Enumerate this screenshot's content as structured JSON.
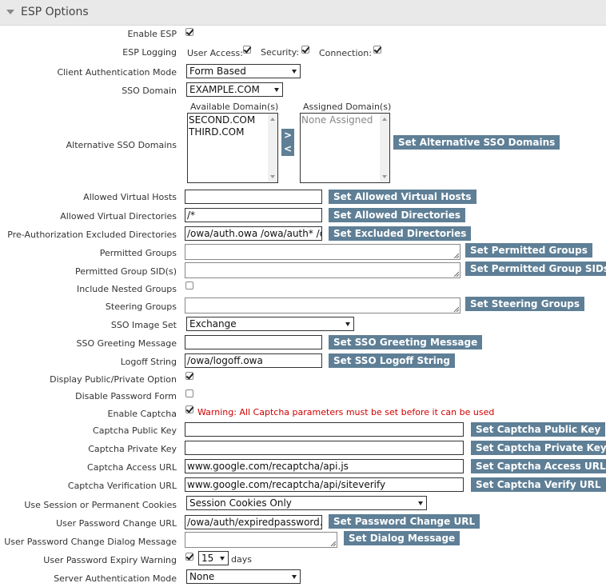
{
  "section_title": "ESP Options",
  "labels": {
    "enable_esp": "Enable ESP",
    "esp_logging": "ESP Logging",
    "client_auth_mode": "Client Authentication Mode",
    "sso_domain": "SSO Domain",
    "alt_sso_domains": "Alternative SSO Domains",
    "allowed_virtual_hosts": "Allowed Virtual Hosts",
    "allowed_virtual_dirs": "Allowed Virtual Directories",
    "preauth_excluded_dirs": "Pre-Authorization Excluded Directories",
    "permitted_groups": "Permitted Groups",
    "permitted_group_sids": "Permitted Group SID(s)",
    "include_nested_groups": "Include Nested Groups",
    "steering_groups": "Steering Groups",
    "sso_image_set": "SSO Image Set",
    "sso_greeting_message": "SSO Greeting Message",
    "logoff_string": "Logoff String",
    "display_public_private": "Display Public/Private Option",
    "disable_password_form": "Disable Password Form",
    "enable_captcha": "Enable Captcha",
    "captcha_public_key": "Captcha Public Key",
    "captcha_private_key": "Captcha Private Key",
    "captcha_access_url": "Captcha Access URL",
    "captcha_verification_url": "Captcha Verification URL",
    "session_cookies": "Use Session or Permanent Cookies",
    "password_change_url": "User Password Change URL",
    "password_change_dialog": "User Password Change Dialog Message",
    "password_expiry_warning": "User Password Expiry Warning",
    "server_auth_mode": "Server Authentication Mode"
  },
  "logging": {
    "user_access": "User Access:",
    "security": "Security:",
    "connection": "Connection:"
  },
  "checks": {
    "enable_esp": true,
    "user_access": true,
    "security": true,
    "connection": true,
    "include_nested_groups": false,
    "display_public_private": true,
    "disable_password_form": false,
    "enable_captcha": true,
    "password_expiry_warning": true
  },
  "selects": {
    "client_auth_mode": "Form Based",
    "sso_domain": "EXAMPLE.COM",
    "sso_image_set": "Exchange",
    "session_cookies": "Session Cookies Only",
    "expiry_days": "15",
    "server_auth_mode": "None"
  },
  "domains": {
    "available_header": "Available Domain(s)",
    "assigned_header": "Assigned Domain(s)",
    "available": [
      "SECOND.COM",
      "THIRD.COM"
    ],
    "assigned_placeholder": "None Assigned",
    "move_right": ">",
    "move_left": "<"
  },
  "values": {
    "allowed_virtual_hosts": "",
    "allowed_virtual_dirs": "/*",
    "preauth_excluded_dirs": "/owa/auth.owa /owa/auth* /o",
    "sso_greeting_message": "",
    "logoff_string": "/owa/logoff.owa",
    "captcha_public_key": "",
    "captcha_private_key": "",
    "captcha_access_url": "www.google.com/recaptcha/api.js",
    "captcha_verification_url": "www.google.com/recaptcha/api/siteverify",
    "password_change_url": "/owa/auth/expiredpassword.a"
  },
  "buttons": {
    "set_alt_sso_domains": "Set Alternative SSO Domains",
    "set_allowed_virtual_hosts": "Set Allowed Virtual Hosts",
    "set_allowed_directories": "Set Allowed Directories",
    "set_excluded_directories": "Set Excluded Directories",
    "set_permitted_groups": "Set Permitted Groups",
    "set_permitted_group_sids": "Set Permitted Group SIDs",
    "set_steering_groups": "Set Steering Groups",
    "set_sso_greeting": "Set SSO Greeting Message",
    "set_sso_logoff": "Set SSO Logoff String",
    "set_captcha_public_key": "Set Captcha Public Key",
    "set_captcha_private_key": "Set Captcha Private Key",
    "set_captcha_access_url": "Set Captcha Access URL",
    "set_captcha_verify_url": "Set Captcha Verify URL",
    "set_password_change_url": "Set Password Change URL",
    "set_dialog_message": "Set Dialog Message"
  },
  "warnings": {
    "captcha": "Warning: All Captcha parameters must be set before it can be used"
  },
  "units": {
    "days": "days"
  },
  "colors": {
    "button_bg": "#5e7f96",
    "header_bg": "#e9e9e9",
    "warning": "#d00000"
  }
}
